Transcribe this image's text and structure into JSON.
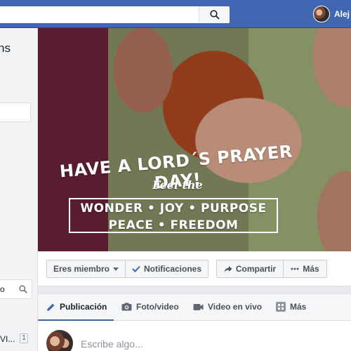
{
  "topbar": {
    "search_icon": "search-icon",
    "user_name": "Alej"
  },
  "left": {
    "title_fragment": "ns",
    "search_text": "o",
    "list_item": "VI...",
    "list_count": "1"
  },
  "cover": {
    "headline": "HAVE A LORD´S PRAYER DAY!",
    "subline": "Feel the",
    "box_line1": "WONDER • JOY • PURPOSE",
    "box_line2": "PEACE • FREEDOM"
  },
  "actions": {
    "member_label": "Eres miembro",
    "notifications_label": "Notificaciones",
    "share_label": "Compartir",
    "more_label": "Más"
  },
  "composer": {
    "tabs": [
      {
        "label": "Publicación",
        "icon": "pencil-icon"
      },
      {
        "label": "Foto/video",
        "icon": "camera-icon"
      },
      {
        "label": "Video en vivo",
        "icon": "video-camera-icon"
      },
      {
        "label": "Más",
        "icon": "grid-icon"
      }
    ],
    "placeholder": "Escribe algo..."
  },
  "colors": {
    "brand": "#4267b2",
    "background": "#e9ebee",
    "text_secondary": "#4b4f56"
  }
}
